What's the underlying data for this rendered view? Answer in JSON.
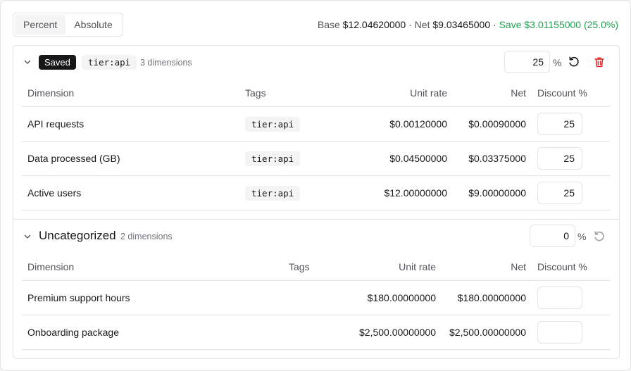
{
  "toolbar": {
    "modes": [
      {
        "label": "Percent",
        "active": true
      },
      {
        "label": "Absolute",
        "active": false
      }
    ],
    "summary": {
      "base_label": "Base",
      "base_value": "$12.04620000",
      "sep1": "·",
      "net_label": "Net",
      "net_value": "$9.03465000",
      "sep2": "·",
      "save_text": "Save $3.01155000 (25.0%)"
    }
  },
  "groups": [
    {
      "status": "Saved",
      "tag": "tier:api",
      "dimension_count": "3 dimensions",
      "percent_value": "25",
      "percent_sign": "%",
      "columns": [
        "Dimension",
        "Tags",
        "Unit rate",
        "Net",
        "Discount %"
      ],
      "rows": [
        {
          "dimension": "API requests",
          "tag": "tier:api",
          "unit_rate": "$0.00120000",
          "net": "$0.00090000",
          "discount": "25"
        },
        {
          "dimension": "Data processed (GB)",
          "tag": "tier:api",
          "unit_rate": "$0.04500000",
          "net": "$0.03375000",
          "discount": "25"
        },
        {
          "dimension": "Active users",
          "tag": "tier:api",
          "unit_rate": "$12.00000000",
          "net": "$9.00000000",
          "discount": "25"
        }
      ]
    },
    {
      "title": "Uncategorized",
      "dimension_count": "2 dimensions",
      "percent_value": "0",
      "percent_sign": "%",
      "columns": [
        "Dimension",
        "Tags",
        "Unit rate",
        "Net",
        "Discount %"
      ],
      "rows": [
        {
          "dimension": "Premium support hours",
          "tag": "",
          "unit_rate": "$180.00000000",
          "net": "$180.00000000",
          "discount": ""
        },
        {
          "dimension": "Onboarding package",
          "tag": "",
          "unit_rate": "$2,500.00000000",
          "net": "$2,500.00000000",
          "discount": ""
        }
      ]
    }
  ],
  "colors": {
    "accent_save": "#22a052",
    "delete": "#dc2626",
    "saved_badge": "#18181b"
  },
  "icons": {
    "collapse": "chevron-down-icon",
    "reset": "rotate-ccw-icon",
    "delete": "trash-icon"
  }
}
